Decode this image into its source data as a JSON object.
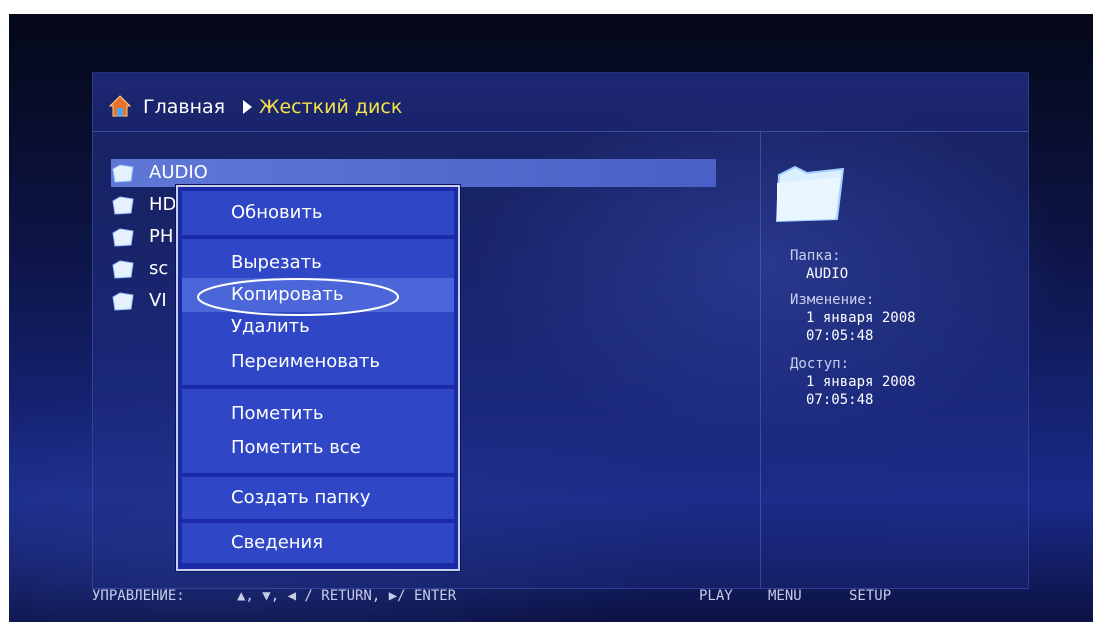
{
  "breadcrumb": {
    "home_label": "Главная",
    "current_label": "Жесткий диск",
    "home_icon": "home-icon",
    "current_color": "#f3e24a"
  },
  "file_list": {
    "items": [
      {
        "label": "AUDIO",
        "icon": "folder-icon",
        "selected": true
      },
      {
        "label": "HD",
        "icon": "folder-icon",
        "selected": false
      },
      {
        "label": "PH",
        "icon": "folder-icon",
        "selected": false
      },
      {
        "label": "sc",
        "icon": "folder-icon",
        "selected": false
      },
      {
        "label": "VI",
        "icon": "folder-icon",
        "selected": false
      }
    ]
  },
  "context_menu": {
    "refresh": "Обновить",
    "cut": "Вырезать",
    "copy": "Копировать",
    "delete": "Удалить",
    "rename": "Переименовать",
    "mark": "Пометить",
    "mark_all": "Пометить все",
    "create_folder": "Создать папку",
    "info": "Сведения",
    "highlighted_item": "Копировать"
  },
  "info_panel": {
    "folder_label": "Папка:",
    "folder_value": "AUDIO",
    "modified_label": "Изменение:",
    "modified_date": "1 января 2008",
    "modified_time": "07:05:48",
    "access_label": "Доступ:",
    "access_date": "1 января 2008",
    "access_time": "07:05:48"
  },
  "footer": {
    "controls_label": "УПРАВЛЕНИЕ:",
    "controls_keys": "▲, ▼, ◀ / RETURN, ▶/ ENTER",
    "play": "PLAY",
    "menu": "MENU",
    "setup": "SETUP"
  },
  "colors": {
    "selection": "#5f78d6",
    "menu_background": "#2f47c6",
    "menu_highlight": "#4a66d8"
  }
}
